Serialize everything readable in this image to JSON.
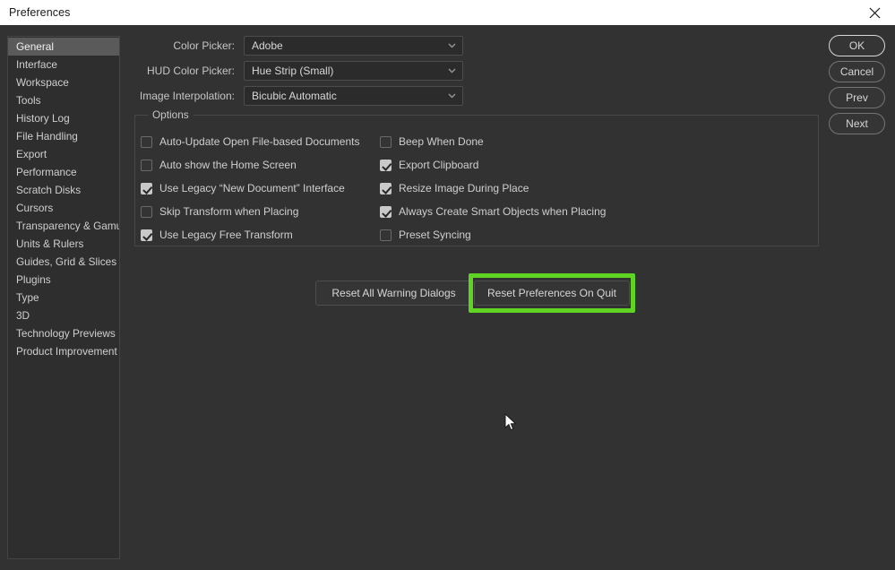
{
  "window": {
    "title": "Preferences",
    "close_icon": "close-icon"
  },
  "sidebar": {
    "items": [
      {
        "label": "General",
        "selected": true
      },
      {
        "label": "Interface",
        "selected": false
      },
      {
        "label": "Workspace",
        "selected": false
      },
      {
        "label": "Tools",
        "selected": false
      },
      {
        "label": "History Log",
        "selected": false
      },
      {
        "label": "File Handling",
        "selected": false
      },
      {
        "label": "Export",
        "selected": false
      },
      {
        "label": "Performance",
        "selected": false
      },
      {
        "label": "Scratch Disks",
        "selected": false
      },
      {
        "label": "Cursors",
        "selected": false
      },
      {
        "label": "Transparency & Gamut",
        "selected": false
      },
      {
        "label": "Units & Rulers",
        "selected": false
      },
      {
        "label": "Guides, Grid & Slices",
        "selected": false
      },
      {
        "label": "Plugins",
        "selected": false
      },
      {
        "label": "Type",
        "selected": false
      },
      {
        "label": "3D",
        "selected": false
      },
      {
        "label": "Technology Previews",
        "selected": false
      },
      {
        "label": "Product Improvement",
        "selected": false
      }
    ]
  },
  "fields": [
    {
      "label": "Color Picker:",
      "value": "Adobe",
      "icon": "chevron-down-icon"
    },
    {
      "label": "HUD Color Picker:",
      "value": "Hue Strip (Small)",
      "icon": "chevron-down-icon"
    },
    {
      "label": "Image Interpolation:",
      "value": "Bicubic Automatic",
      "icon": "chevron-down-icon"
    }
  ],
  "options": {
    "legend": "Options",
    "left_column": [
      {
        "label": "Auto-Update Open File-based Documents",
        "checked": false
      },
      {
        "label": "Auto show the Home Screen",
        "checked": false
      },
      {
        "label": "Use Legacy “New Document” Interface",
        "checked": true
      },
      {
        "label": "Skip Transform when Placing",
        "checked": false
      },
      {
        "label": "Use Legacy Free Transform",
        "checked": true
      }
    ],
    "right_column": [
      {
        "label": "Beep When Done",
        "checked": false
      },
      {
        "label": "Export Clipboard",
        "checked": true
      },
      {
        "label": "Resize Image During Place",
        "checked": true
      },
      {
        "label": "Always Create Smart Objects when Placing",
        "checked": true
      },
      {
        "label": "Preset Syncing",
        "checked": false
      }
    ]
  },
  "reset_buttons": {
    "warnings_label": "Reset All Warning Dialogs",
    "preferences_label": "Reset Preferences On Quit"
  },
  "side_buttons": [
    {
      "label": "OK",
      "primary": true
    },
    {
      "label": "Cancel",
      "primary": false
    },
    {
      "label": "Prev",
      "primary": false
    },
    {
      "label": "Next",
      "primary": false
    }
  ],
  "annotation": {
    "highlight_color": "#5FD321",
    "target": "Reset Preferences On Quit"
  },
  "colors": {
    "dialog_background": "#323232",
    "panel_background": "#2e2e2e",
    "titlebar_background": "#ffffff",
    "selection": "#5a5a5a",
    "text": "#cfcfcf"
  }
}
